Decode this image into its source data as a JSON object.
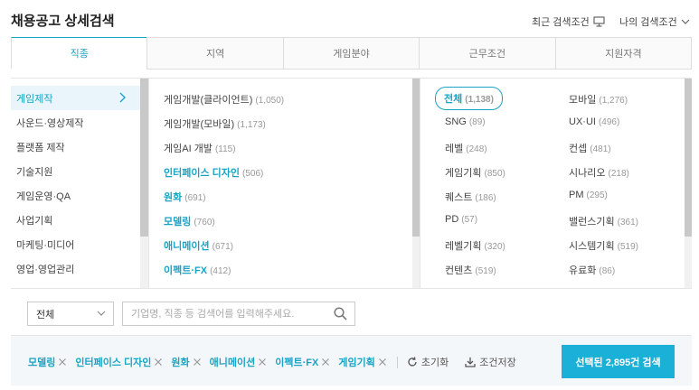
{
  "header": {
    "title": "채용공고 상세검색",
    "recent_label": "최근 검색조건",
    "mine_label": "나의 검색조건"
  },
  "tabs": [
    {
      "label": "직종",
      "active": true
    },
    {
      "label": "지역"
    },
    {
      "label": "게임분야"
    },
    {
      "label": "근무조건"
    },
    {
      "label": "지원자격"
    }
  ],
  "categories": [
    {
      "label": "게임제작",
      "active": true
    },
    {
      "label": "사운드·영상제작"
    },
    {
      "label": "플랫폼 제작"
    },
    {
      "label": "기술지원"
    },
    {
      "label": "게임운영·QA"
    },
    {
      "label": "사업기획"
    },
    {
      "label": "마케팅·미디어"
    },
    {
      "label": "영업·영업관리"
    }
  ],
  "subcategories": [
    {
      "label": "게임개발(클라이언트)",
      "count": "(1,050)"
    },
    {
      "label": "게임개발(모바일)",
      "count": "(1,173)"
    },
    {
      "label": "게임AI 개발",
      "count": "(115)"
    },
    {
      "label": "인터페이스 디자인",
      "count": "(506)",
      "selected": true
    },
    {
      "label": "원화",
      "count": "(691)",
      "selected": true
    },
    {
      "label": "모델링",
      "count": "(760)",
      "selected": true
    },
    {
      "label": "애니메이션",
      "count": "(671)",
      "selected": true
    },
    {
      "label": "이펙트·FX",
      "count": "(412)",
      "selected": true
    }
  ],
  "specialties_left": [
    {
      "label": "전체",
      "count": "(1,138)",
      "selected": true
    },
    {
      "label": "SNG",
      "count": "(89)"
    },
    {
      "label": "레벨",
      "count": "(248)"
    },
    {
      "label": "게임기획",
      "count": "(850)"
    },
    {
      "label": "퀘스트",
      "count": "(186)"
    },
    {
      "label": "PD",
      "count": "(57)"
    },
    {
      "label": "레벨기획",
      "count": "(320)"
    },
    {
      "label": "컨텐츠",
      "count": "(519)"
    }
  ],
  "specialties_right": [
    {
      "label": "모바일",
      "count": "(1,276)"
    },
    {
      "label": "UX·UI",
      "count": "(496)"
    },
    {
      "label": "컨셉",
      "count": "(481)"
    },
    {
      "label": "시나리오",
      "count": "(218)"
    },
    {
      "label": "PM",
      "count": "(295)"
    },
    {
      "label": "밸런스기획",
      "count": "(361)"
    },
    {
      "label": "시스템기획",
      "count": "(519)"
    },
    {
      "label": "유료화",
      "count": "(86)"
    }
  ],
  "search": {
    "select_value": "전체",
    "placeholder": "기업명, 직종 등 검색어를 입력해주세요."
  },
  "chips": [
    "모델링",
    "인터페이스 디자인",
    "원화",
    "애니메이션",
    "이펙트·FX",
    "게임기획"
  ],
  "actions": {
    "reset_label": "초기화",
    "save_label": "조건저장"
  },
  "submit_label": "선택된 2,895건 검색",
  "colors": {
    "accent": "#1aa3c4",
    "button": "#1ab0d7"
  }
}
